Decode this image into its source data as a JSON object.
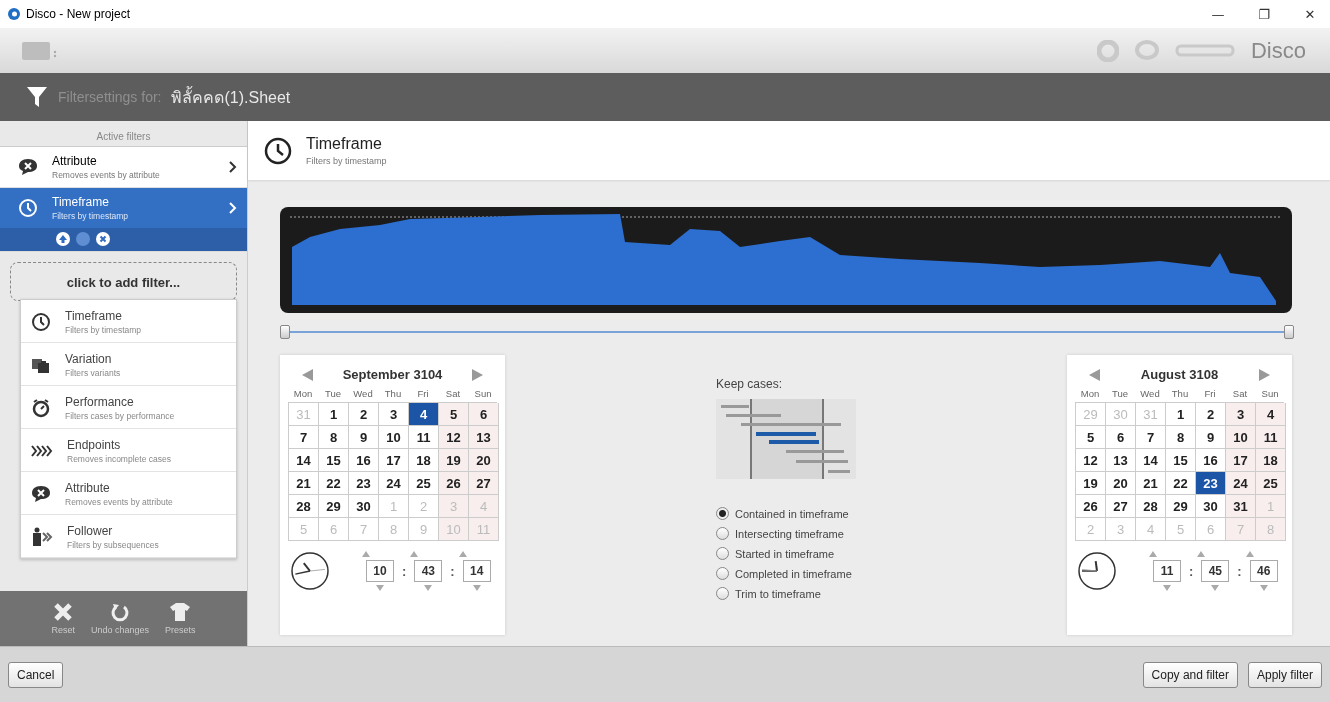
{
  "window": {
    "title": "Disco - New project",
    "controls": [
      "—",
      "❐",
      "✕"
    ]
  },
  "toolbar": {
    "logo": "Disco"
  },
  "filter_header": {
    "label": "Filtersettings for:",
    "dataset": "พิลั้คคด(1).Sheet"
  },
  "sidebar": {
    "heading": "Active filters",
    "active_filters": [
      {
        "kind": "attribute",
        "title": "Attribute",
        "subtitle": "Removes events by attribute",
        "selected": false
      },
      {
        "kind": "timeframe",
        "title": "Timeframe",
        "subtitle": "Filters by timestamp",
        "selected": true
      }
    ],
    "add_filter": "click to add filter...",
    "menu": [
      {
        "kind": "timeframe",
        "title": "Timeframe",
        "subtitle": "Filters by timestamp"
      },
      {
        "kind": "variation",
        "title": "Variation",
        "subtitle": "Filters variants"
      },
      {
        "kind": "performance",
        "title": "Performance",
        "subtitle": "Filters cases by performance"
      },
      {
        "kind": "endpoints",
        "title": "Endpoints",
        "subtitle": "Removes incomplete cases"
      },
      {
        "kind": "attribute",
        "title": "Attribute",
        "subtitle": "Removes events by attribute"
      },
      {
        "kind": "follower",
        "title": "Follower",
        "subtitle": "Filters by subsequences"
      }
    ],
    "actions": [
      {
        "kind": "reset",
        "label": "Reset"
      },
      {
        "kind": "undo",
        "label": "Undo changes"
      },
      {
        "kind": "presets",
        "label": "Presets"
      }
    ]
  },
  "panel": {
    "title": "Timeframe",
    "subtitle": "Filters by timestamp"
  },
  "range": {
    "handles": [
      {
        "level": 0
      },
      {
        "level": 1
      }
    ]
  },
  "start": {
    "month": "September 3104",
    "weekdays": [
      "Mon",
      "Tue",
      "Wed",
      "Thu",
      "Fri",
      "Sat",
      "Sun"
    ],
    "weeks": [
      [
        {
          "d": "31",
          "muted": true,
          "selected": false
        },
        {
          "d": "1",
          "muted": false,
          "selected": false
        },
        {
          "d": "2",
          "muted": false,
          "selected": false
        },
        {
          "d": "3",
          "muted": false,
          "selected": false
        },
        {
          "d": "4",
          "muted": false,
          "selected": true
        },
        {
          "d": "5",
          "muted": false,
          "selected": false
        },
        {
          "d": "6",
          "muted": false,
          "selected": false
        }
      ],
      [
        {
          "d": "7",
          "muted": false,
          "selected": false
        },
        {
          "d": "8",
          "muted": false,
          "selected": false
        },
        {
          "d": "9",
          "muted": false,
          "selected": false
        },
        {
          "d": "10",
          "muted": false,
          "selected": false
        },
        {
          "d": "11",
          "muted": false,
          "selected": false
        },
        {
          "d": "12",
          "muted": false,
          "selected": false
        },
        {
          "d": "13",
          "muted": false,
          "selected": false
        }
      ],
      [
        {
          "d": "14",
          "muted": false,
          "selected": false
        },
        {
          "d": "15",
          "muted": false,
          "selected": false
        },
        {
          "d": "16",
          "muted": false,
          "selected": false
        },
        {
          "d": "17",
          "muted": false,
          "selected": false
        },
        {
          "d": "18",
          "muted": false,
          "selected": false
        },
        {
          "d": "19",
          "muted": false,
          "selected": false
        },
        {
          "d": "20",
          "muted": false,
          "selected": false
        }
      ],
      [
        {
          "d": "21",
          "muted": false,
          "selected": false
        },
        {
          "d": "22",
          "muted": false,
          "selected": false
        },
        {
          "d": "23",
          "muted": false,
          "selected": false
        },
        {
          "d": "24",
          "muted": false,
          "selected": false
        },
        {
          "d": "25",
          "muted": false,
          "selected": false
        },
        {
          "d": "26",
          "muted": false,
          "selected": false
        },
        {
          "d": "27",
          "muted": false,
          "selected": false
        }
      ],
      [
        {
          "d": "28",
          "muted": false,
          "selected": false
        },
        {
          "d": "29",
          "muted": false,
          "selected": false
        },
        {
          "d": "30",
          "muted": false,
          "selected": false
        },
        {
          "d": "1",
          "muted": true,
          "selected": false
        },
        {
          "d": "2",
          "muted": true,
          "selected": false
        },
        {
          "d": "3",
          "muted": true,
          "selected": false
        },
        {
          "d": "4",
          "muted": true,
          "selected": false
        }
      ],
      [
        {
          "d": "5",
          "muted": true,
          "selected": false
        },
        {
          "d": "6",
          "muted": true,
          "selected": false
        },
        {
          "d": "7",
          "muted": true,
          "selected": false
        },
        {
          "d": "8",
          "muted": true,
          "selected": false
        },
        {
          "d": "9",
          "muted": true,
          "selected": false
        },
        {
          "d": "10",
          "muted": true,
          "selected": false
        },
        {
          "d": "11",
          "muted": true,
          "selected": false
        }
      ]
    ],
    "time": {
      "hour": "10",
      "minute": "43",
      "second": "14",
      "separators": [
        ":",
        ":"
      ]
    }
  },
  "keep_cases": {
    "label": "Keep cases:",
    "options": [
      {
        "label": "Contained in timeframe",
        "selected": true
      },
      {
        "label": "Intersecting timeframe",
        "selected": false
      },
      {
        "label": "Started in timeframe",
        "selected": false
      },
      {
        "label": "Completed in timeframe",
        "selected": false
      },
      {
        "label": "Trim to timeframe",
        "selected": false
      }
    ]
  },
  "end": {
    "month": "August 3108",
    "weekdays": [
      "Mon",
      "Tue",
      "Wed",
      "Thu",
      "Fri",
      "Sat",
      "Sun"
    ],
    "weeks": [
      [
        {
          "d": "29",
          "muted": true,
          "selected": false
        },
        {
          "d": "30",
          "muted": true,
          "selected": false
        },
        {
          "d": "31",
          "muted": true,
          "selected": false
        },
        {
          "d": "1",
          "muted": false,
          "selected": false
        },
        {
          "d": "2",
          "muted": false,
          "selected": false
        },
        {
          "d": "3",
          "muted": false,
          "selected": false
        },
        {
          "d": "4",
          "muted": false,
          "selected": false
        }
      ],
      [
        {
          "d": "5",
          "muted": false,
          "selected": false
        },
        {
          "d": "6",
          "muted": false,
          "selected": false
        },
        {
          "d": "7",
          "muted": false,
          "selected": false
        },
        {
          "d": "8",
          "muted": false,
          "selected": false
        },
        {
          "d": "9",
          "muted": false,
          "selected": false
        },
        {
          "d": "10",
          "muted": false,
          "selected": false
        },
        {
          "d": "11",
          "muted": false,
          "selected": false
        }
      ],
      [
        {
          "d": "12",
          "muted": false,
          "selected": false
        },
        {
          "d": "13",
          "muted": false,
          "selected": false
        },
        {
          "d": "14",
          "muted": false,
          "selected": false
        },
        {
          "d": "15",
          "muted": false,
          "selected": false
        },
        {
          "d": "16",
          "muted": false,
          "selected": false
        },
        {
          "d": "17",
          "muted": false,
          "selected": false
        },
        {
          "d": "18",
          "muted": false,
          "selected": false
        }
      ],
      [
        {
          "d": "19",
          "muted": false,
          "selected": false
        },
        {
          "d": "20",
          "muted": false,
          "selected": false
        },
        {
          "d": "21",
          "muted": false,
          "selected": false
        },
        {
          "d": "22",
          "muted": false,
          "selected": false
        },
        {
          "d": "23",
          "muted": false,
          "selected": true
        },
        {
          "d": "24",
          "muted": false,
          "selected": false
        },
        {
          "d": "25",
          "muted": false,
          "selected": false
        }
      ],
      [
        {
          "d": "26",
          "muted": false,
          "selected": false
        },
        {
          "d": "27",
          "muted": false,
          "selected": false
        },
        {
          "d": "28",
          "muted": false,
          "selected": false
        },
        {
          "d": "29",
          "muted": false,
          "selected": false
        },
        {
          "d": "30",
          "muted": false,
          "selected": false
        },
        {
          "d": "31",
          "muted": false,
          "selected": false
        },
        {
          "d": "1",
          "muted": true,
          "selected": false
        }
      ],
      [
        {
          "d": "2",
          "muted": true,
          "selected": false
        },
        {
          "d": "3",
          "muted": true,
          "selected": false
        },
        {
          "d": "4",
          "muted": true,
          "selected": false
        },
        {
          "d": "5",
          "muted": true,
          "selected": false
        },
        {
          "d": "6",
          "muted": true,
          "selected": false
        },
        {
          "d": "7",
          "muted": true,
          "selected": false
        },
        {
          "d": "8",
          "muted": true,
          "selected": false
        }
      ]
    ],
    "time": {
      "hour": "11",
      "minute": "45",
      "second": "46",
      "separators": [
        ":",
        ":"
      ]
    }
  },
  "footer": {
    "cancel": "Cancel",
    "buttons": [
      "Copy and filter",
      "Apply filter"
    ]
  }
}
